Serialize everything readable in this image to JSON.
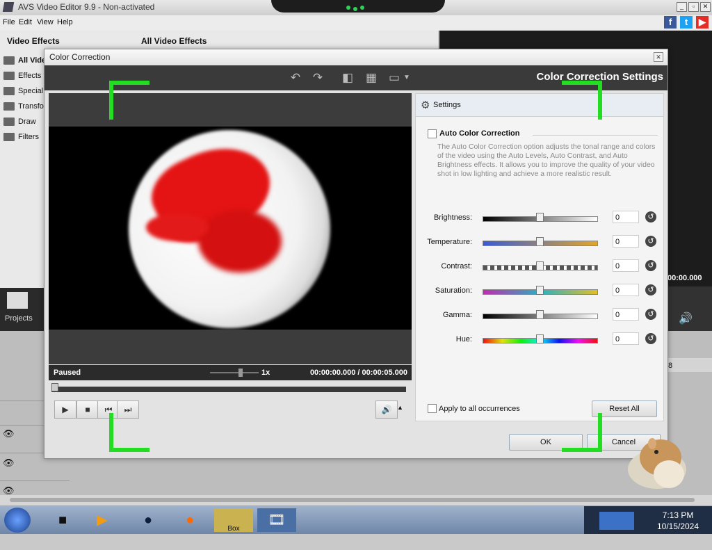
{
  "app": {
    "title": "AVS Video Editor 9.9 - Non-activated"
  },
  "menu": [
    "File",
    "Edit",
    "View",
    "Help"
  ],
  "left_pane": {
    "header_left": "Video Effects",
    "header_right": "All Video Effects",
    "items": [
      "All Vide",
      "Effects",
      "Special",
      "Transfo",
      "Draw",
      "Filters"
    ],
    "projects_label": "Projects",
    "timecode": "00:00.000",
    "ruler_digit": "8"
  },
  "dialog": {
    "title": "Color Correction",
    "heading": "Color Correction Settings",
    "status": "Paused",
    "speed": "1x",
    "timecode": "00:00:00.000  /  00:00:05.000",
    "settings_label": "Settings",
    "auto_label": "Auto Color Correction",
    "auto_checked": false,
    "auto_desc": "The Auto Color Correction option adjusts the tonal range and colors of the video using the Auto Levels, Auto Contrast, and Auto Brightness effects. It allows you to improve the quality of your video shot in low lighting and achieve a more realistic result.",
    "sliders": [
      {
        "name": "Brightness:",
        "value": "0",
        "level": 0.5,
        "gradient": "linear-gradient(90deg,#000,#fff)"
      },
      {
        "name": "Temperature:",
        "value": "0",
        "level": 0.5,
        "gradient": "linear-gradient(90deg,#3a5bd6,#e0a62a)"
      },
      {
        "name": "Contrast:",
        "value": "0",
        "level": 0.5,
        "gradient": "repeating-linear-gradient(90deg,#555 0 6px,#fff 6px 10px)"
      },
      {
        "name": "Saturation:",
        "value": "0",
        "level": 0.5,
        "gradient": "linear-gradient(90deg,#c02bb0,#2bb0c0,#e0c02b)"
      },
      {
        "name": "Gamma:",
        "value": "0",
        "level": 0.5,
        "gradient": "linear-gradient(90deg,#000,#fff)"
      },
      {
        "name": "Hue:",
        "value": "0",
        "level": 0.5,
        "gradient": "linear-gradient(90deg,#e11,#e0e010,#1e1,#1ee,#11e,#e1e,#e11)"
      }
    ],
    "apply_label": "Apply to all occurrences",
    "apply_checked": false,
    "reset_all": "Reset All",
    "ok": "OK",
    "cancel": "Cancel"
  },
  "taskbar": {
    "time": "7:13 PM",
    "date": "10/15/2024",
    "box_label": "Box"
  }
}
